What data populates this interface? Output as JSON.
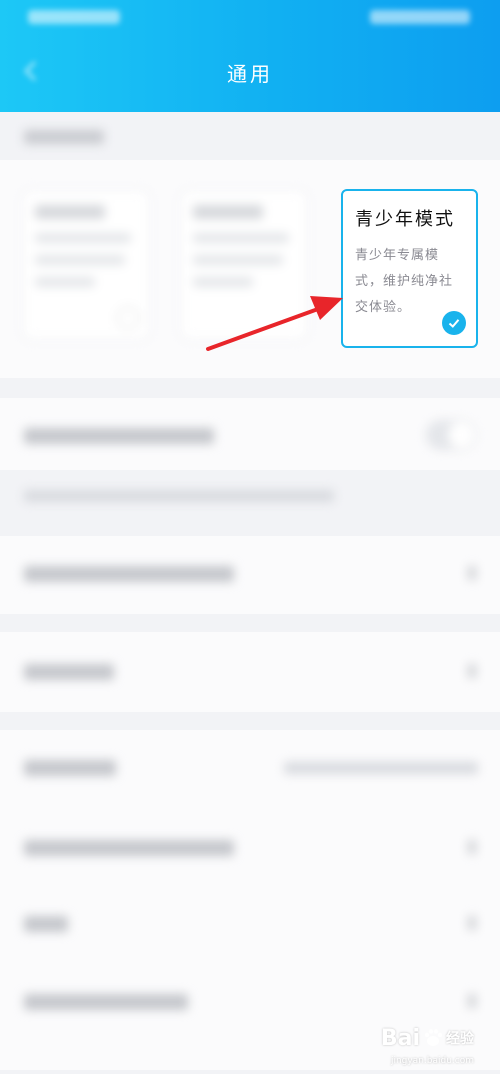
{
  "header": {
    "title": "通用",
    "background_color": "#11b0f2"
  },
  "youth_mode_card": {
    "title": "青少年模式",
    "description": "青少年专属模式，维护纯净社交体验。",
    "selected": true,
    "accent_color": "#19b3ec"
  },
  "icons": {
    "back": "back-arrow-icon",
    "check": "check-icon",
    "chevron": "chevron-right-icon",
    "annotation_arrow_color": "#e8252a"
  },
  "watermark": {
    "brand": "Bai",
    "paw": "paw-icon",
    "suffix": "经验",
    "url": "jingyan.baidu.com"
  }
}
